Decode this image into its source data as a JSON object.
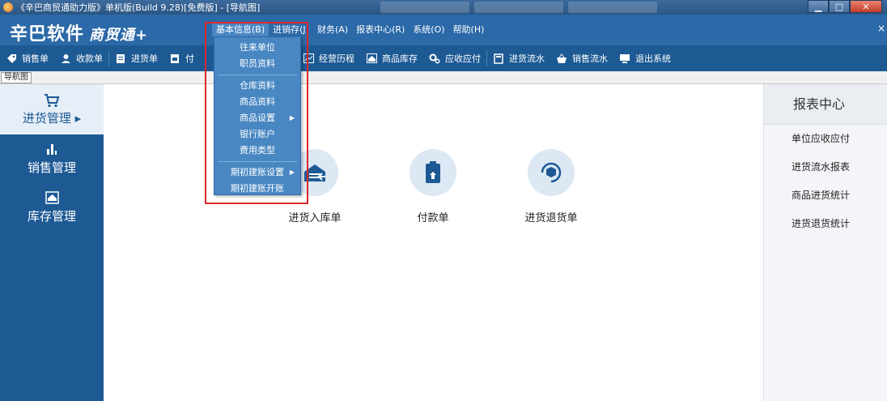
{
  "window": {
    "title": "《辛巴商贸通助力版》单机版(Build 9.28)[免费版] - [导航图]",
    "min_glyph": "▁",
    "max_glyph": "□",
    "close_glyph": "✕"
  },
  "header": {
    "logo_text": "辛巴软件",
    "logo_sub": "商贸通+",
    "close_glyph": "×",
    "menus": [
      {
        "label": "基本信息(B)"
      },
      {
        "label": "进销存(J)"
      },
      {
        "label": "财务(A)"
      },
      {
        "label": "报表中心(R)"
      },
      {
        "label": "系统(O)"
      },
      {
        "label": "帮助(H)"
      }
    ]
  },
  "toolbar": {
    "buttons": [
      {
        "label": "销售单",
        "icon": "tag-icon"
      },
      {
        "label": "收款单",
        "icon": "user-money-icon"
      },
      {
        "label": "进货单",
        "icon": "list-icon"
      },
      {
        "label": "付",
        "icon": "document-icon"
      },
      {
        "label": "经营历程",
        "icon": "chart-icon"
      },
      {
        "label": "商品库存",
        "icon": "warehouse-icon"
      },
      {
        "label": "应收应付",
        "icon": "gears-icon"
      },
      {
        "label": "进货流水",
        "icon": "book-icon"
      },
      {
        "label": "销售流水",
        "icon": "basket-icon"
      },
      {
        "label": "退出系统",
        "icon": "monitor-icon"
      }
    ]
  },
  "tabs": {
    "nav_label": "导航图"
  },
  "leftnav": {
    "items": [
      {
        "label": "进货管理 ▸",
        "icon": "cart-icon"
      },
      {
        "label": "销售管理",
        "icon": "bar-chart-icon"
      },
      {
        "label": "库存管理",
        "icon": "home-icon"
      }
    ]
  },
  "main": {
    "functions": [
      {
        "label": "进货入库单",
        "icon": "inbound-icon"
      },
      {
        "label": "付款单",
        "icon": "payment-icon"
      },
      {
        "label": "进货退货单",
        "icon": "return-icon"
      }
    ]
  },
  "rightpanel": {
    "title": "报表中心",
    "items": [
      {
        "label": "单位应收应付"
      },
      {
        "label": "进货流水报表"
      },
      {
        "label": "商品进货统计"
      },
      {
        "label": "进货退货统计"
      }
    ]
  },
  "dropdown": {
    "groups": [
      [
        {
          "label": "往来单位"
        },
        {
          "label": "职员资料"
        }
      ],
      [
        {
          "label": "仓库资料"
        },
        {
          "label": "商品资料"
        },
        {
          "label": "商品设置",
          "submenu": true
        },
        {
          "label": "银行账户"
        },
        {
          "label": "费用类型"
        }
      ],
      [
        {
          "label": "期初建账设置",
          "submenu": true
        },
        {
          "label": "期初建账开账"
        }
      ]
    ]
  },
  "colors": {
    "header_blue": "#2b69a8",
    "toolbar_blue": "#1d5a94",
    "menu_blue": "#4887c2",
    "highlight_red": "#e0262b"
  }
}
